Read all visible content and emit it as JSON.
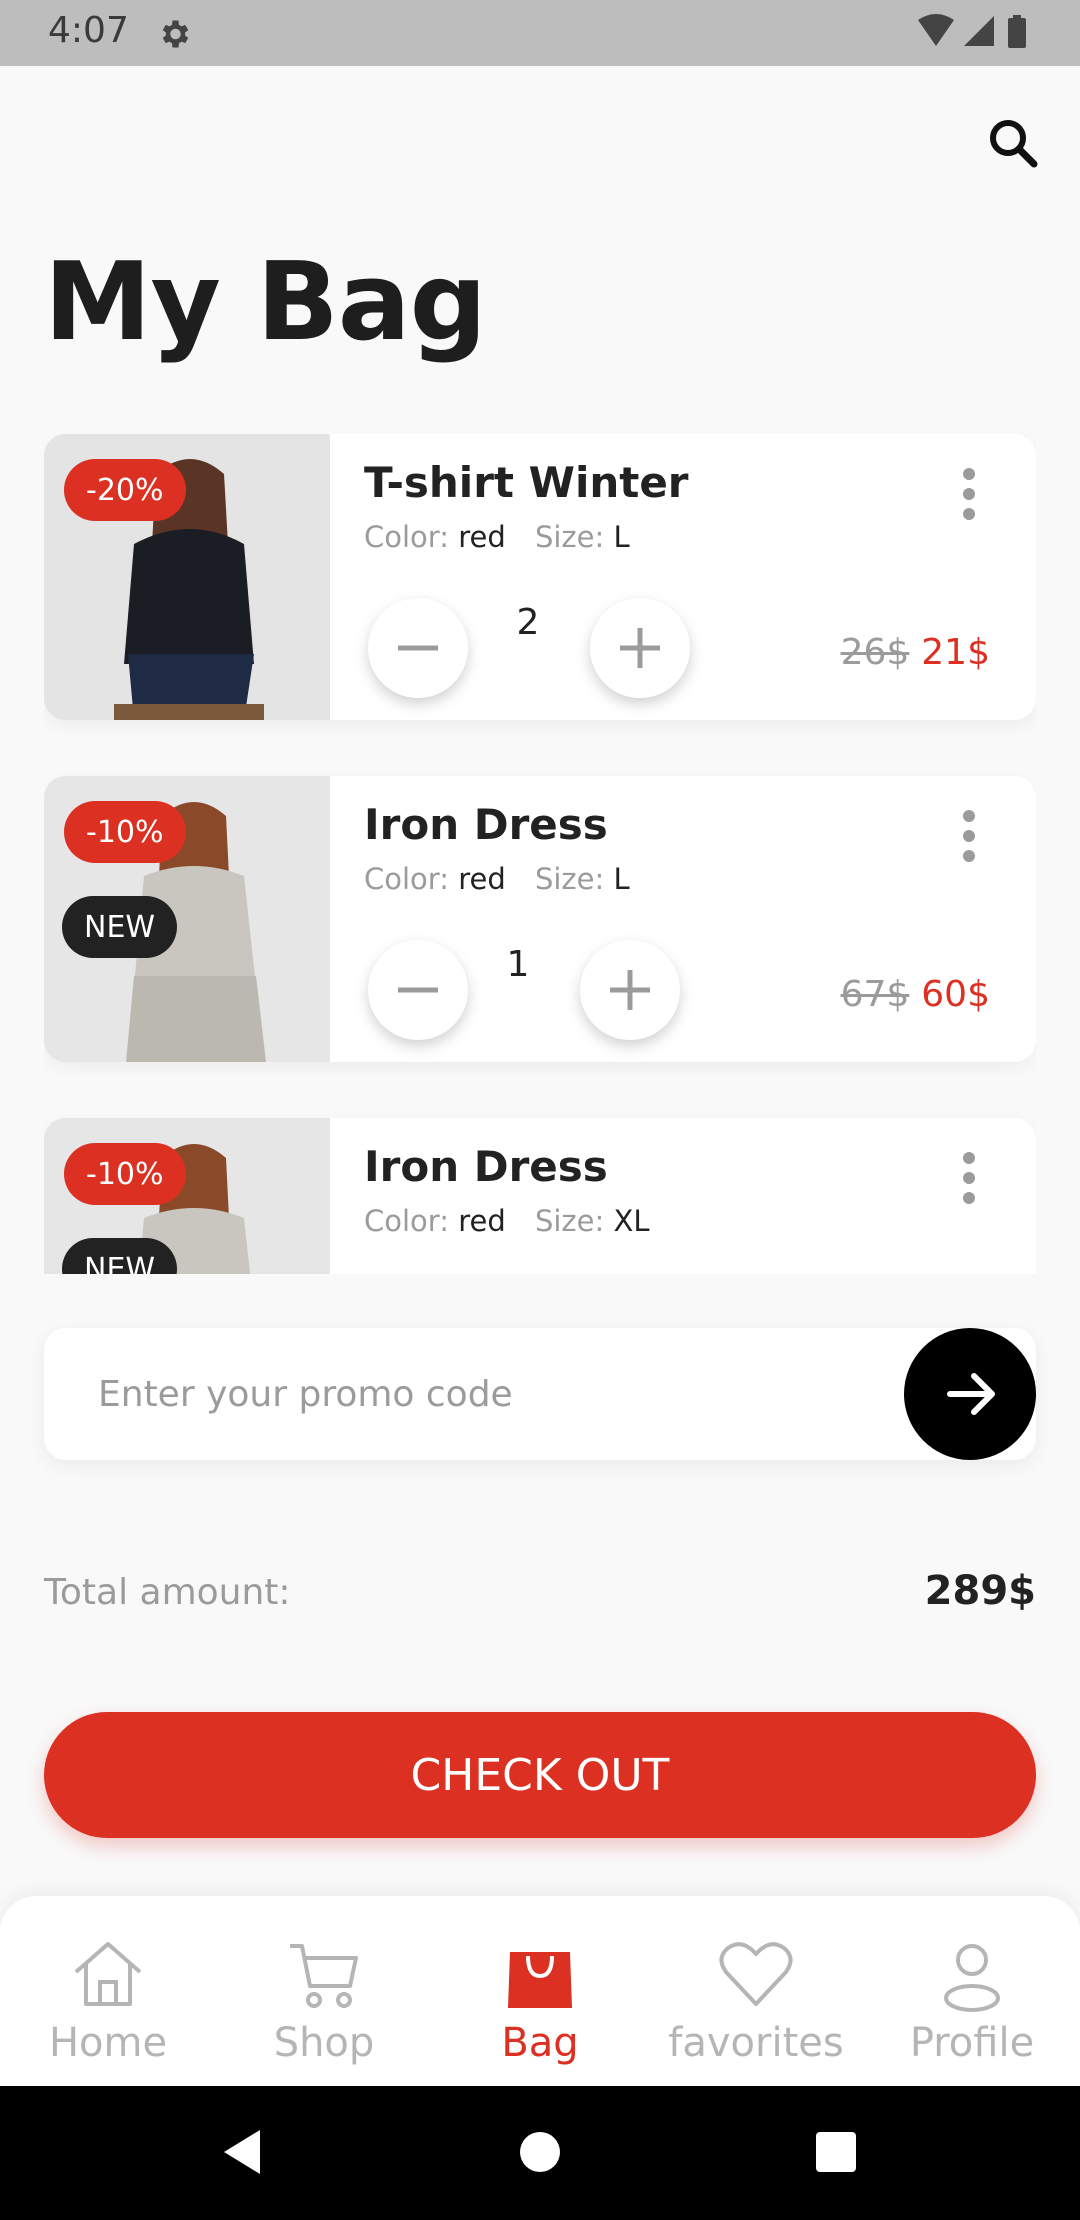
{
  "status_bar": {
    "time": "4:07"
  },
  "header": {
    "title": "My Bag"
  },
  "cart": {
    "items": [
      {
        "name": "T-shirt Winter",
        "color_label": "Color:",
        "color": "red",
        "size_label": "Size:",
        "size": "L",
        "quantity": "2",
        "old_price": "26$",
        "new_price": "21$",
        "discount": "-20%"
      },
      {
        "name": "Iron Dress",
        "color_label": "Color:",
        "color": "red",
        "size_label": "Size:",
        "size": "L",
        "quantity": "1",
        "old_price": "67$",
        "new_price": "60$",
        "discount": "-10%",
        "tag": "NEW"
      },
      {
        "name": "Iron Dress",
        "color_label": "Color:",
        "color": "red",
        "size_label": "Size:",
        "size": "XL",
        "discount": "-10%",
        "tag": "NEW"
      }
    ]
  },
  "promo": {
    "placeholder": "Enter your promo code"
  },
  "total": {
    "label": "Total amount:",
    "value": "289$"
  },
  "checkout": {
    "label": "CHECK OUT"
  },
  "nav": {
    "items": [
      {
        "label": "Home",
        "icon": "home-icon"
      },
      {
        "label": "Shop",
        "icon": "cart-icon"
      },
      {
        "label": "Bag",
        "icon": "bag-icon",
        "active": true
      },
      {
        "label": "favorites",
        "icon": "heart-icon"
      },
      {
        "label": "Profile",
        "icon": "profile-icon"
      }
    ]
  },
  "colors": {
    "accent": "#DB3022",
    "dark": "#222222",
    "muted": "#9B9B9B",
    "background": "#F9F9F9"
  }
}
